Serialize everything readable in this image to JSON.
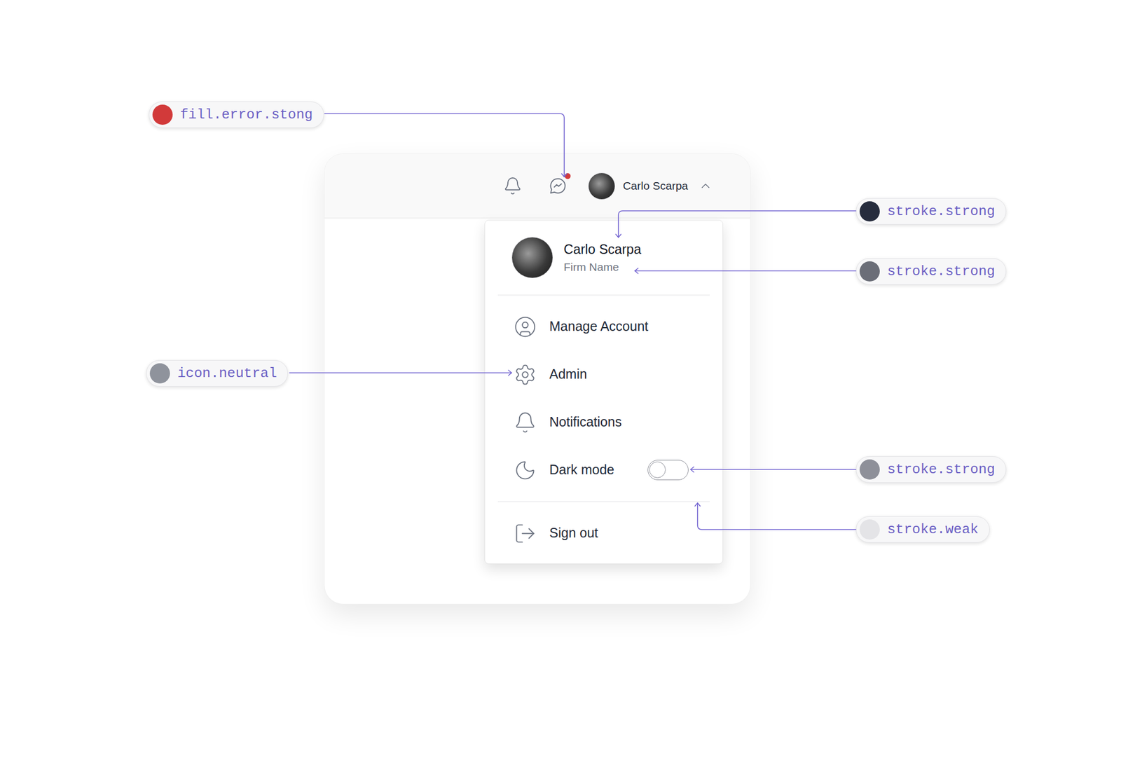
{
  "annotations": [
    {
      "label": "fill.error.stong",
      "color": "#d23a3a"
    },
    {
      "label": "stroke.strong",
      "color": "#262c3d"
    },
    {
      "label": "stroke.strong",
      "color": "#6b6e78"
    },
    {
      "label": "icon.neutral",
      "color": "#8f939c"
    },
    {
      "label": "stroke.strong",
      "color": "#8e9099"
    },
    {
      "label": "stroke.weak",
      "color": "#e4e4e7"
    }
  ],
  "header": {
    "user_name": "Carlo Scarpa",
    "messages_unread": true,
    "menu_expanded": true
  },
  "menu": {
    "user_name": "Carlo Scarpa",
    "firm": "Firm Name",
    "sections": [
      {
        "items": [
          {
            "label": "Manage Account",
            "kind": "link"
          },
          {
            "label": "Admin",
            "kind": "link"
          },
          {
            "label": "Notifications",
            "kind": "link"
          },
          {
            "label": "Dark mode",
            "kind": "toggle",
            "on": false
          }
        ]
      },
      {
        "items": [
          {
            "label": "Sign out",
            "kind": "link"
          }
        ]
      }
    ]
  }
}
